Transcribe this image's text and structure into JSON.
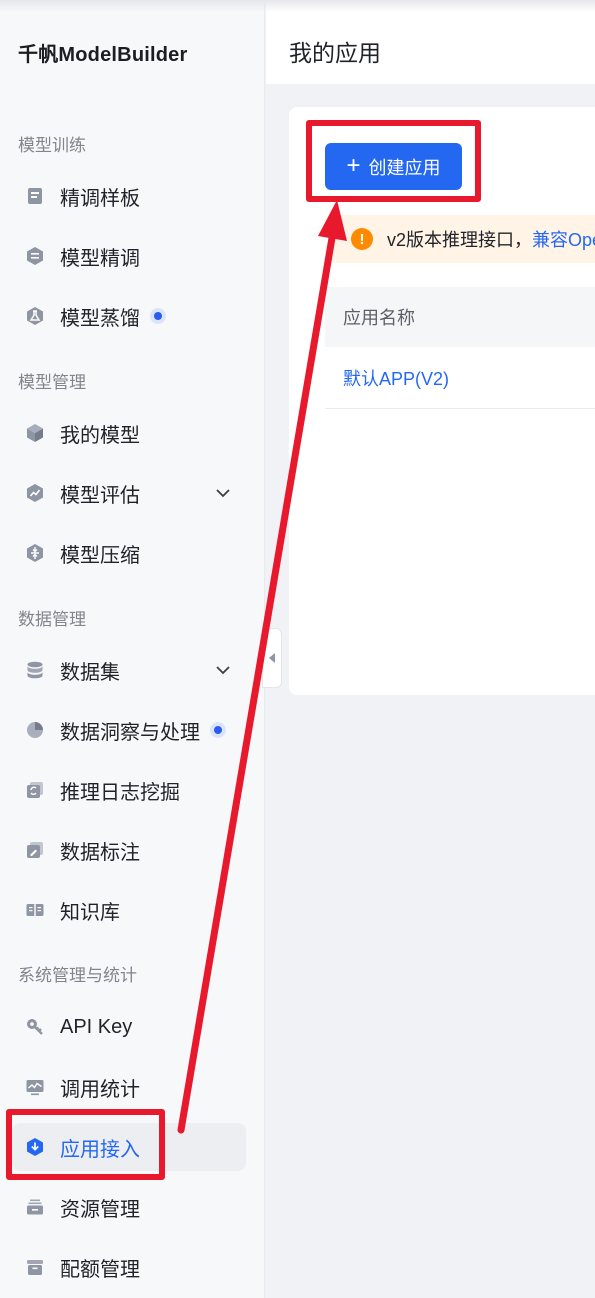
{
  "brand": "千帆ModelBuilder",
  "sidebar": {
    "groups": [
      {
        "title": "模型训练"
      },
      {
        "title": "模型管理"
      },
      {
        "title": "数据管理"
      },
      {
        "title": "系统管理与统计"
      }
    ],
    "items": [
      {
        "label": "精调样板",
        "icon": "template-icon"
      },
      {
        "label": "模型精调",
        "icon": "tune-icon"
      },
      {
        "label": "模型蒸馏",
        "icon": "flask-icon",
        "badge": "new-dot"
      },
      {
        "label": "我的模型",
        "icon": "cube-icon"
      },
      {
        "label": "模型评估",
        "icon": "trend-icon",
        "expandable": true
      },
      {
        "label": "模型压缩",
        "icon": "compress-icon"
      },
      {
        "label": "数据集",
        "icon": "database-icon",
        "expandable": true
      },
      {
        "label": "数据洞察与处理",
        "icon": "pie-icon",
        "badge": "new-dot"
      },
      {
        "label": "推理日志挖掘",
        "icon": "log-icon"
      },
      {
        "label": "数据标注",
        "icon": "annotate-icon"
      },
      {
        "label": "知识库",
        "icon": "book-icon"
      },
      {
        "label": "API Key",
        "icon": "key-icon"
      },
      {
        "label": "调用统计",
        "icon": "stats-icon"
      },
      {
        "label": "应用接入",
        "icon": "download-shield-icon",
        "active": true
      },
      {
        "label": "资源管理",
        "icon": "tray-icon"
      },
      {
        "label": "配额管理",
        "icon": "box-icon"
      }
    ]
  },
  "header": {
    "title": "我的应用"
  },
  "main": {
    "create_button": "创建应用",
    "notice_text": "v2版本推理接口，",
    "notice_link": "兼容Ope",
    "table": {
      "columns": [
        "应用名称"
      ],
      "rows": [
        [
          "默认APP(V2)"
        ]
      ]
    }
  },
  "colors": {
    "accent": "#2468f2",
    "annotation": "#e8192c",
    "warning": "#ff8a00"
  }
}
